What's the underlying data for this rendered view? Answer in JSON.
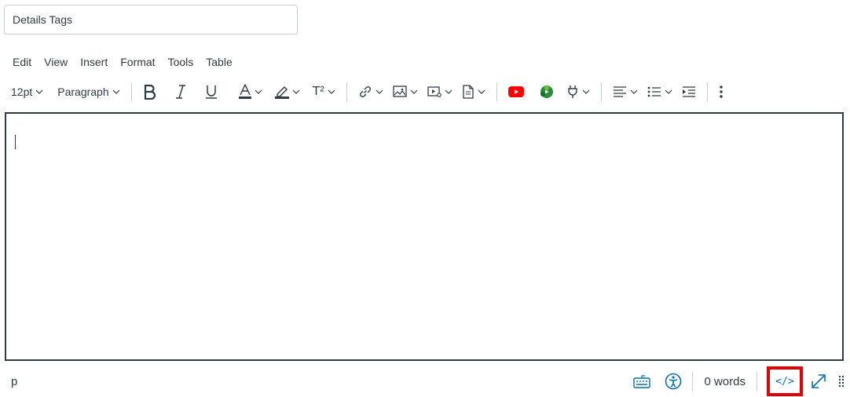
{
  "title_field": {
    "value": "Details Tags",
    "placeholder": ""
  },
  "menubar": {
    "items": [
      "Edit",
      "View",
      "Insert",
      "Format",
      "Tools",
      "Table"
    ]
  },
  "toolbar": {
    "font_size": "12pt",
    "block_format": "Paragraph",
    "superscript_label": "T²"
  },
  "statusbar": {
    "path": "p",
    "word_count": "0 words",
    "html_editor_label": "</>"
  },
  "colors": {
    "text": "#2d3b45",
    "accent_blue": "#0770a3",
    "highlight_box": "#e30000",
    "youtube_red": "#ff0000",
    "plugin_green": "#2a8c3a"
  }
}
